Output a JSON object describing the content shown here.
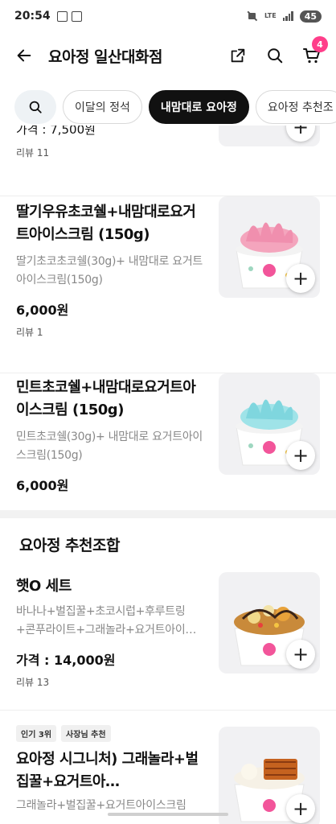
{
  "status_bar": {
    "time": "20:54",
    "network": "LTE",
    "battery": "45"
  },
  "header": {
    "title": "요아정 일산대화점",
    "cart_count": "4"
  },
  "tabs": [
    "이달의 정석",
    "내맘대로 요아정",
    "요아정 추천조"
  ],
  "active_tab": 1,
  "items": [
    {
      "name": "",
      "price": "가격 : 7,500원",
      "review": "리뷰 11"
    },
    {
      "name": "딸기우유초코쉘+내맘대로요거트아이스크림 (150g)",
      "desc": "딸기초코초코쉘(30g)+ 내맘대로 요거트아이스크림(150g)",
      "price": "6,000원",
      "review": "리뷰 1"
    },
    {
      "name": "민트초코쉘+내맘대로요거트아이스크림 (150g)",
      "desc": "민트초코쉘(30g)+ 내맘대로 요거트아이스크림(150g)",
      "price": "6,000원"
    }
  ],
  "section2": {
    "title": "요아정 추천조합",
    "items": [
      {
        "name": "햇O 세트",
        "desc": "바나나+벌집꿀+초코시럽+후루트링 +콘푸라이트+그래놀라+요거트아이…",
        "price": "가격 : 14,000원",
        "review": "리뷰 13"
      },
      {
        "tags": [
          "인기 3위",
          "사장님 추천"
        ],
        "name": "요아정 시그니처) 그래놀라+벌집꿀+요거트아…",
        "desc": "그래놀라+벌집꿀+요거트아이스크림"
      }
    ]
  },
  "colors": {
    "accent": "#ff3e8a",
    "active_tab_bg": "#111111"
  }
}
